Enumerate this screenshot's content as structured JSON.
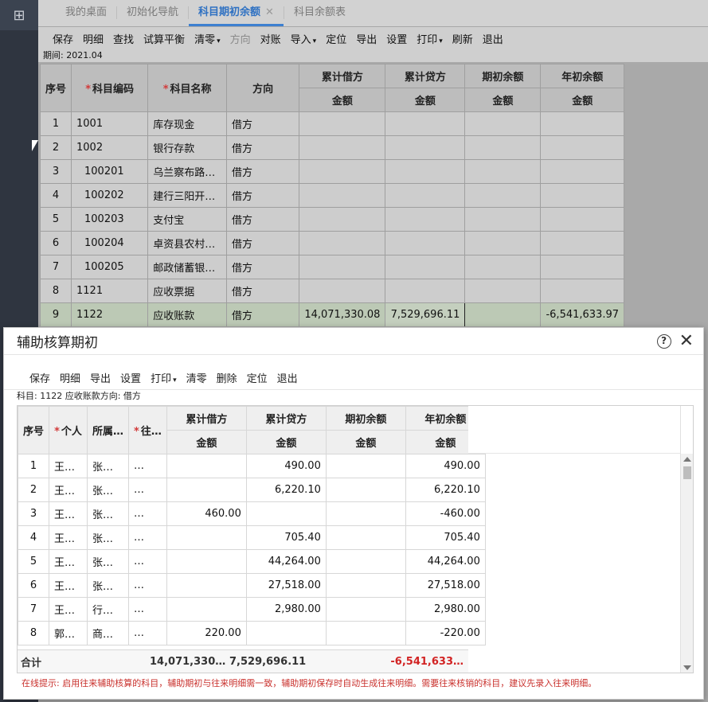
{
  "tabs": [
    {
      "label": "我的桌面"
    },
    {
      "label": "初始化导航"
    },
    {
      "label": "科目期初余额"
    },
    {
      "label": "科目余额表"
    }
  ],
  "toolbar": [
    "保存",
    "明细",
    "查找",
    "试算平衡",
    "清零",
    "方向",
    "对账",
    "导入",
    "定位",
    "导出",
    "设置",
    "打印",
    "刷新",
    "退出"
  ],
  "period": "期间: 2021.04",
  "main_headers": {
    "seq": "序号",
    "code": "科目编码",
    "name": "科目名称",
    "dir": "方向",
    "debit": "累计借方",
    "credit": "累计贷方",
    "open": "期初余额",
    "year": "年初余额",
    "amount": "金额"
  },
  "main_rows": [
    {
      "seq": "1",
      "code": "1001",
      "name": "库存现金",
      "dir": "借方",
      "debit": "",
      "credit": "",
      "open": "",
      "year": ""
    },
    {
      "seq": "2",
      "code": "1002",
      "name": "银行存款",
      "dir": "借方",
      "debit": "",
      "credit": "",
      "open": "",
      "year": ""
    },
    {
      "seq": "3",
      "code": "100201",
      "name": "乌兰察布路…",
      "dir": "借方",
      "debit": "",
      "credit": "",
      "open": "",
      "year": ""
    },
    {
      "seq": "4",
      "code": "100202",
      "name": "建行三阳开…",
      "dir": "借方",
      "debit": "",
      "credit": "",
      "open": "",
      "year": ""
    },
    {
      "seq": "5",
      "code": "100203",
      "name": "支付宝",
      "dir": "借方",
      "debit": "",
      "credit": "",
      "open": "",
      "year": ""
    },
    {
      "seq": "6",
      "code": "100204",
      "name": "卓资县农村…",
      "dir": "借方",
      "debit": "",
      "credit": "",
      "open": "",
      "year": ""
    },
    {
      "seq": "7",
      "code": "100205",
      "name": "邮政储蓄银…",
      "dir": "借方",
      "debit": "",
      "credit": "",
      "open": "",
      "year": ""
    },
    {
      "seq": "8",
      "code": "1121",
      "name": "应收票据",
      "dir": "借方",
      "debit": "",
      "credit": "",
      "open": "",
      "year": ""
    },
    {
      "seq": "9",
      "code": "1122",
      "name": "应收账款",
      "dir": "借方",
      "debit": "14,071,330.08",
      "credit": "7,529,696.11",
      "open": "",
      "year": "-6,541,633.97"
    }
  ],
  "dialog": {
    "title": "辅助核算期初",
    "toolbar": [
      "保存",
      "明细",
      "导出",
      "设置",
      "打印",
      "清零",
      "删除",
      "定位",
      "退出"
    ],
    "subtitle": "科目: 1122 应收账款方向: 借方",
    "headers": {
      "seq": "序号",
      "person": "个人",
      "dept": "所属…",
      "contact": "往…",
      "debit": "累计借方",
      "credit": "累计贷方",
      "open": "期初余额",
      "year": "年初余额",
      "amount": "金额"
    },
    "rows": [
      {
        "seq": "1",
        "person": "王…",
        "dept": "张…",
        "contact": "…",
        "debit": "",
        "credit": "490.00",
        "open": "",
        "year": "490.00"
      },
      {
        "seq": "2",
        "person": "王…",
        "dept": "张…",
        "contact": "…",
        "debit": "",
        "credit": "6,220.10",
        "open": "",
        "year": "6,220.10"
      },
      {
        "seq": "3",
        "person": "王…",
        "dept": "张…",
        "contact": "…",
        "debit": "460.00",
        "credit": "",
        "open": "",
        "year": "-460.00"
      },
      {
        "seq": "4",
        "person": "王…",
        "dept": "张…",
        "contact": "…",
        "debit": "",
        "credit": "705.40",
        "open": "",
        "year": "705.40"
      },
      {
        "seq": "5",
        "person": "王…",
        "dept": "张…",
        "contact": "…",
        "debit": "",
        "credit": "44,264.00",
        "open": "",
        "year": "44,264.00"
      },
      {
        "seq": "6",
        "person": "王…",
        "dept": "张…",
        "contact": "…",
        "debit": "",
        "credit": "27,518.00",
        "open": "",
        "year": "27,518.00"
      },
      {
        "seq": "7",
        "person": "王…",
        "dept": "行…",
        "contact": "…",
        "debit": "",
        "credit": "2,980.00",
        "open": "",
        "year": "2,980.00"
      },
      {
        "seq": "8",
        "person": "郭…",
        "dept": "商…",
        "contact": "…",
        "debit": "220.00",
        "credit": "",
        "open": "",
        "year": "-220.00"
      }
    ],
    "total": {
      "label": "合计",
      "debit": "14,071,330…",
      "credit": "7,529,696.11",
      "year": "-6,541,633…"
    },
    "tip": "在线提示: 启用往来辅助核算的科目，辅助期初与往来明细需一致，辅助期初保存时自动生成往来明细。需要往来核销的科目，建议先录入往来明细。"
  },
  "colors": {
    "accent": "#3d80d0",
    "negative": "#d22323",
    "highlight_row": "#bcc9b5"
  }
}
